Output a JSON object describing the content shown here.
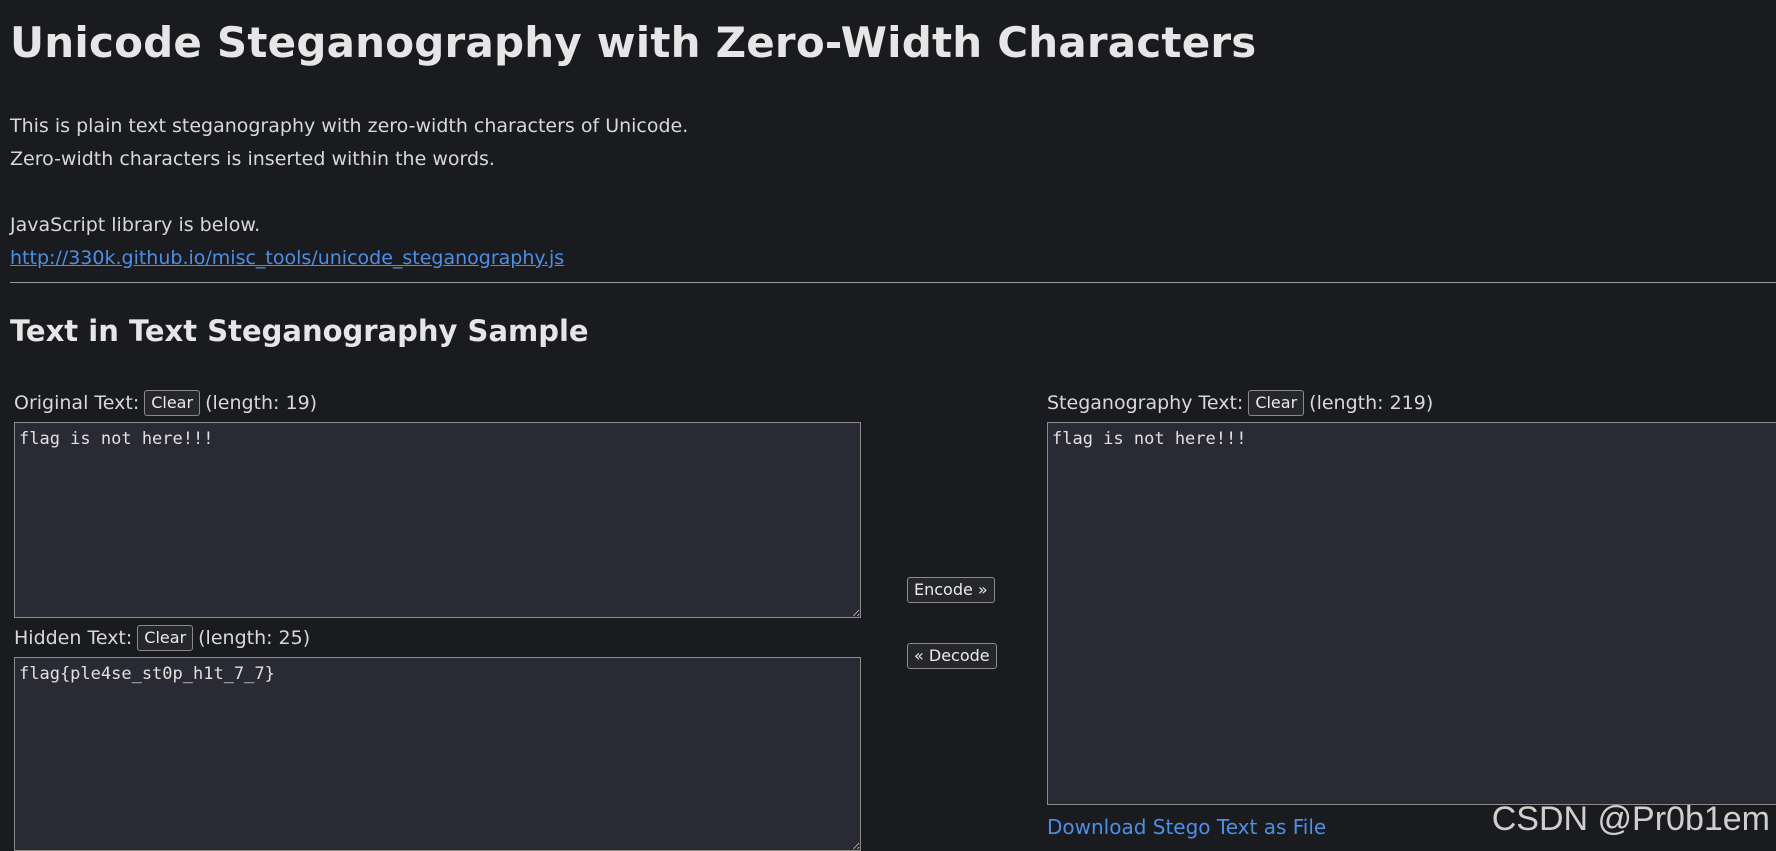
{
  "page": {
    "title": "Unicode Steganography with Zero-Width Characters",
    "intro": {
      "line1": "This is plain text steganography with zero-width characters of Unicode.",
      "line2": "Zero-width characters is inserted within the words.",
      "line3": "JavaScript library is below.",
      "library_link": "http://330k.github.io/misc_tools/unicode_steganography.js"
    },
    "section_title": "Text in Text Steganography Sample"
  },
  "original": {
    "label": "Original Text:",
    "clear_label": "Clear",
    "length_text": "(length: 19)",
    "value": "flag is not here!!!"
  },
  "hidden": {
    "label": "Hidden Text:",
    "clear_label": "Clear",
    "length_text": "(length: 25)",
    "value": "flag{ple4se_st0p_h1t_7_7}"
  },
  "actions": {
    "encode_label": "Encode »",
    "decode_label": "« Decode"
  },
  "stego": {
    "label": "Steganography Text:",
    "clear_label": "Clear",
    "length_text": "(length: 219)",
    "value": "flag is not here!!!",
    "download_label": "Download Stego Text as File"
  },
  "watermark": "CSDN @Pr0b1em",
  "colors": {
    "background": "#1a1b1e",
    "text": "#d8d8d8",
    "link": "#4c8fe6",
    "textarea_bg": "#2a2a34"
  }
}
